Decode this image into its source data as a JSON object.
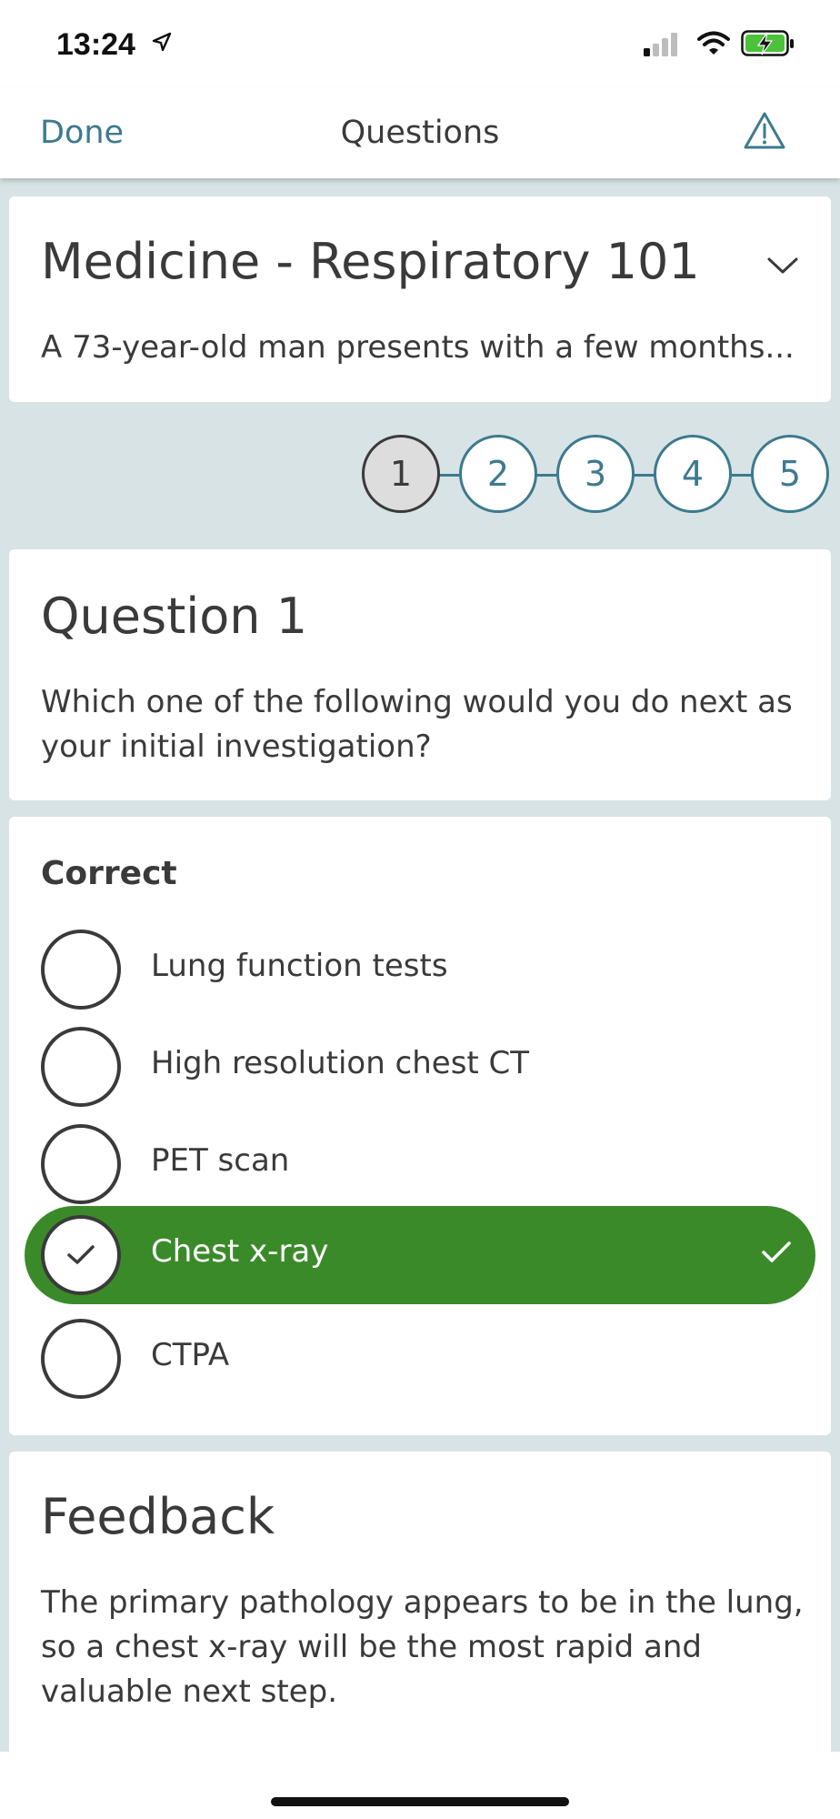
{
  "status_bar": {
    "time": "13:24",
    "icons": [
      "location-arrow-icon",
      "cellular-signal-icon",
      "wifi-icon",
      "battery-charging-icon"
    ]
  },
  "nav": {
    "done_label": "Done",
    "title": "Questions",
    "right_icon": "warning-triangle-icon"
  },
  "case": {
    "title": "Medicine - Respiratory 101",
    "summary": "A 73-year-old man presents with a few months...",
    "toggle_icon": "chevron-down-icon"
  },
  "stepper": {
    "steps": [
      "1",
      "2",
      "3",
      "4",
      "5"
    ],
    "current": "1"
  },
  "question": {
    "title": "Question 1",
    "text": "Which one of the following would you do next as your initial investigation?"
  },
  "answers": {
    "result_label": "Correct",
    "options": [
      {
        "label": "Lung function tests",
        "selected": false
      },
      {
        "label": "High resolution chest CT",
        "selected": false
      },
      {
        "label": "PET scan",
        "selected": false
      },
      {
        "label": "Chest x-ray",
        "selected": true
      },
      {
        "label": "CTPA",
        "selected": false
      }
    ]
  },
  "feedback": {
    "title": "Feedback",
    "text": "The primary pathology appears to be in the lung, so a chest x-ray will be the most rapid and valuable next step."
  },
  "colors": {
    "accent": "#3d7a8e",
    "correct_green": "#3b8a2a",
    "background": "#d8e3e6",
    "text": "#3a3a3a"
  }
}
